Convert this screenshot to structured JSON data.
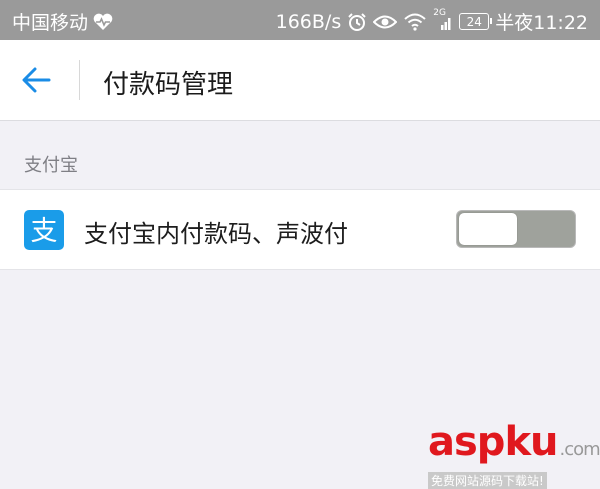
{
  "status_bar": {
    "carrier": "中国移动",
    "net_speed": "166B/s",
    "network_type": "2G",
    "battery": "24",
    "time": "半夜11:22",
    "icons": [
      "heart-pulse-icon",
      "alarm-icon",
      "eye-icon",
      "wifi-icon",
      "signal-icon",
      "battery-icon"
    ]
  },
  "nav": {
    "title": "付款码管理",
    "back_icon": "arrow-left-icon",
    "accent_color": "#1a8ce6"
  },
  "section": {
    "title": "支付宝"
  },
  "setting": {
    "label": "支付宝内付款码、声波付",
    "icon": "alipay-logo-icon",
    "toggle_on": false,
    "icon_color": "#1a9ce9"
  },
  "watermark": {
    "main_a": "asp",
    "main_b": "ku",
    "suffix": ".com",
    "sub": "免费网站源码下载站!"
  }
}
